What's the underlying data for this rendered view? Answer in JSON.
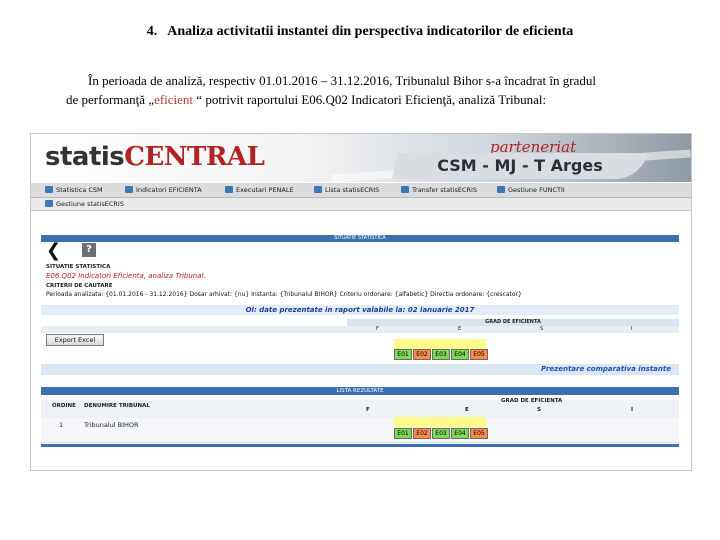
{
  "doc": {
    "section_number": "4.",
    "section_title": "Analiza activitatii instantei din perspectiva indicatorilor de eficienta",
    "para_line1": "În perioada de analiză, respectiv 01.01.2016 – 31.12.2016, Tribunalul Bihor s-a încadrat în gradul",
    "para_line2_a": "de performanţă „",
    "para_line2_highlight": "eficient",
    "para_line2_b": " “ potrivit raportului E06.Q02 Indicatori Eficienţă, analiză Tribunal:"
  },
  "screenshot": {
    "logo_part1": "statis",
    "logo_part2": "CENTRAL",
    "partner_label": "parteneriat",
    "partner_text": "CSM - MJ - T Arges",
    "menu": [
      {
        "label": "Statistica CSM",
        "icon": "stats-icon"
      },
      {
        "label": "Indicatori EFICIENTA",
        "icon": "stats-icon"
      },
      {
        "label": "Executari PENALE",
        "icon": "stats-icon"
      },
      {
        "label": "Lista statisECRIS",
        "icon": "list-icon"
      },
      {
        "label": "Transfer statisECRIS",
        "icon": "transfer-icon"
      },
      {
        "label": "Gestiune FUNCTII",
        "icon": "gear-icon"
      }
    ],
    "menu2": "Gestiune statisECRIS",
    "tab_title": "SITUATIE STATISTICA",
    "situatie_label": "SITUATIE STATISTICA",
    "situatie_value": "E06.Q02 Indicatori Eficienta, analiza Tribunal.",
    "criterii_label": "CRITERII DE CAUTARE",
    "criterii_line": "Perioada analizata: {01.01.2016 - 31.12.2016} Dosar arhivat: {nu} Instanta: {Tribunalul BIHOR} Criteriu ordonare: {alfabetic} Directia ordonare: {crescator}",
    "date_note": "Ol: date prezentate in raport valabile la: 02 ianuarie 2017",
    "grad_label": "GRAD DE EFICIENTA",
    "grad_cols": [
      "F",
      "E",
      "S",
      "I"
    ],
    "export_label": "Export Excel",
    "levels": [
      "E01",
      "E02",
      "E03",
      "E04",
      "E05"
    ],
    "levels_colors": [
      "#7ed957",
      "#ff8a47",
      "#7ed957",
      "#7ed957",
      "#ff8a47"
    ],
    "link_text": "Prezentare comparativa instante",
    "lista_title": "LISTA REZULTATE",
    "col_ordine": "ORDINE",
    "col_denumire": "DENUMIRE TRIBUNAL",
    "row_ordine": "1",
    "row_denumire": "Tribunalul BIHOR"
  }
}
